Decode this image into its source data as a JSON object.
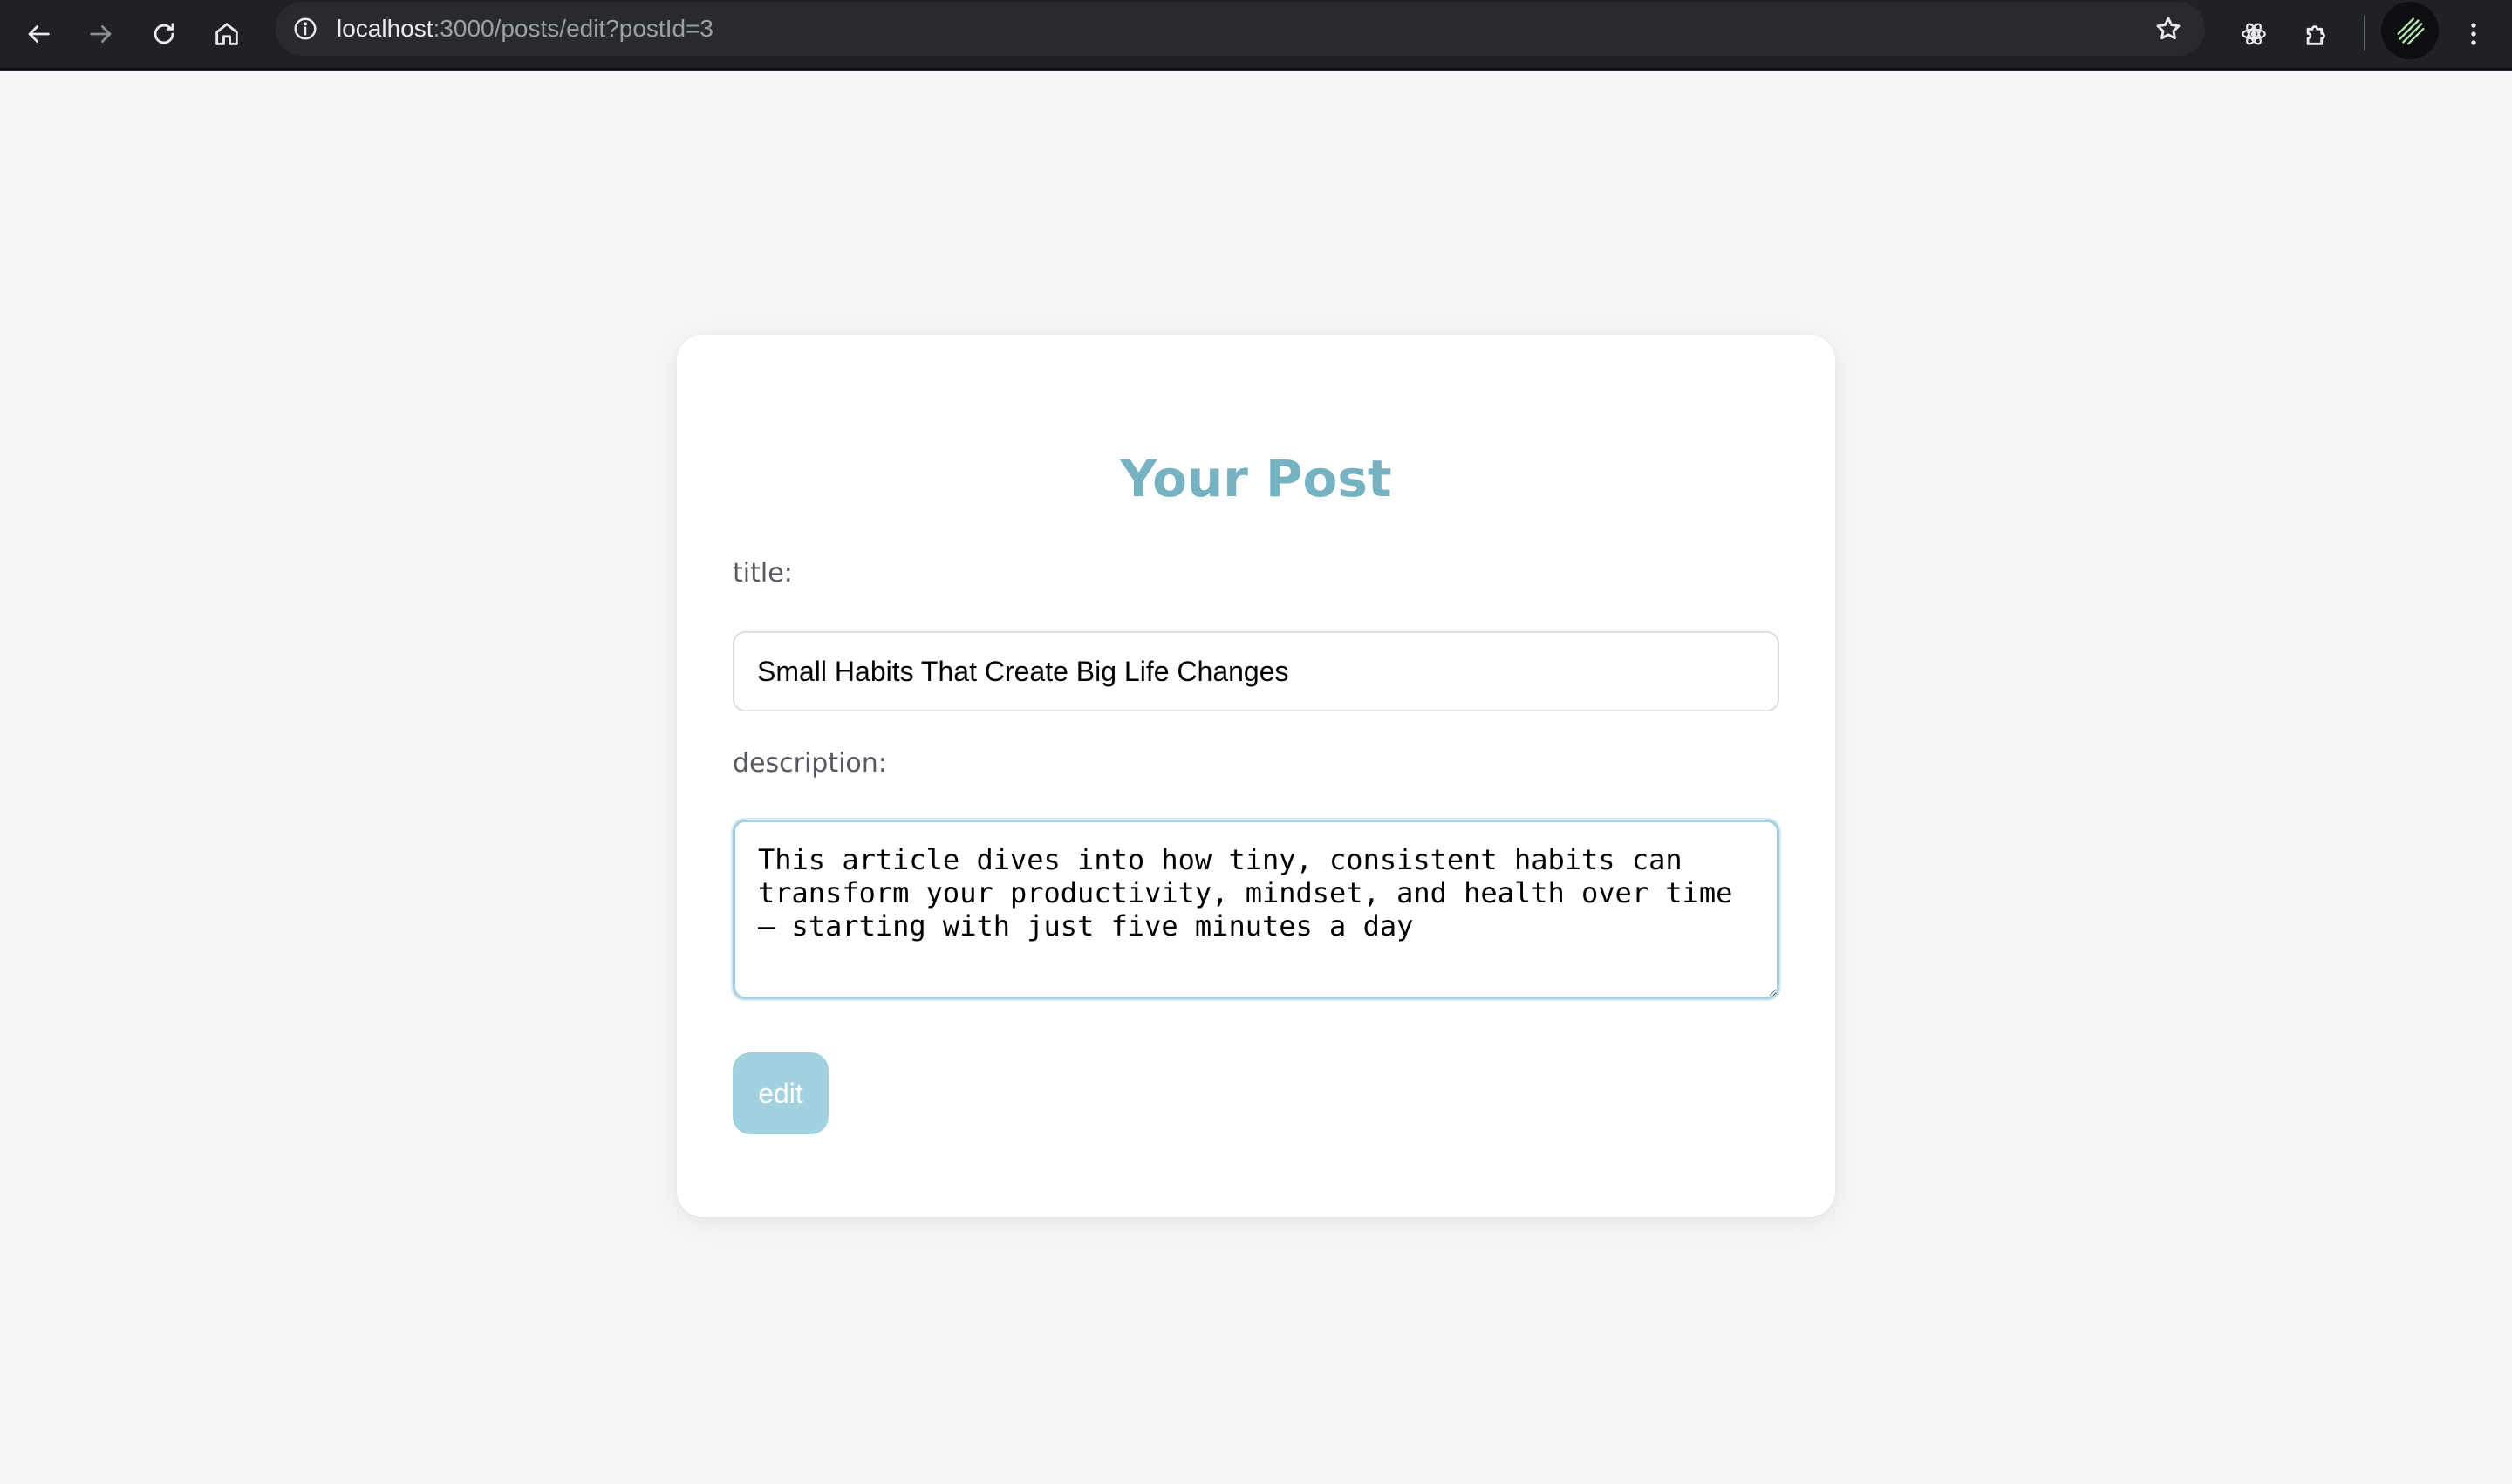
{
  "browser": {
    "url_host": "localhost",
    "url_rest": ":3000/posts/edit?postId=3",
    "icons": {
      "back": "back-arrow-icon",
      "forward": "forward-arrow-icon",
      "reload": "reload-icon",
      "home": "home-icon",
      "site_info": "info-icon",
      "bookmark": "star-icon",
      "react_devtools": "atom-icon",
      "extensions": "puzzle-icon",
      "profile": "avatar",
      "menu": "kebab-menu-icon"
    },
    "forward_enabled": false
  },
  "form": {
    "heading": "Your Post",
    "title_label": "title:",
    "title_value": "Small Habits That Create Big Life Changes",
    "description_label": "description:",
    "description_value": "This article dives into how tiny, consistent habits can transform your productivity, mindset, and health over time — starting with just five minutes a day",
    "submit_label": "edit"
  },
  "colors": {
    "heading": "#75b2c2",
    "button_bg": "#a2d1df",
    "page_bg": "#f5f6f8",
    "focus_border": "#a8cfe2"
  }
}
